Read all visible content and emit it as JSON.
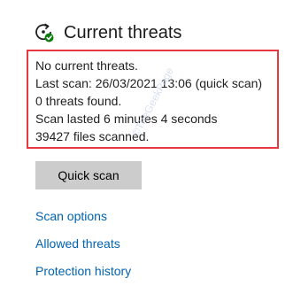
{
  "section": {
    "title": "Current threats",
    "icon": "refresh-shield-icon",
    "accent_color": "#107c10"
  },
  "status": {
    "lines": [
      "No current threats.",
      "Last scan: 26/03/2021 13:06 (quick scan)",
      "0 threats found.",
      "Scan lasted 6 minutes 4 seconds",
      "39427 files scanned."
    ],
    "highlight_color": "#e8383f"
  },
  "actions": {
    "quick_scan_label": "Quick scan"
  },
  "links": {
    "scan_options": "Scan options",
    "allowed_threats": "Allowed threats",
    "protection_history": "Protection history",
    "color": "#0063b1"
  },
  "watermark": {
    "text": "©TheGeekPage"
  }
}
